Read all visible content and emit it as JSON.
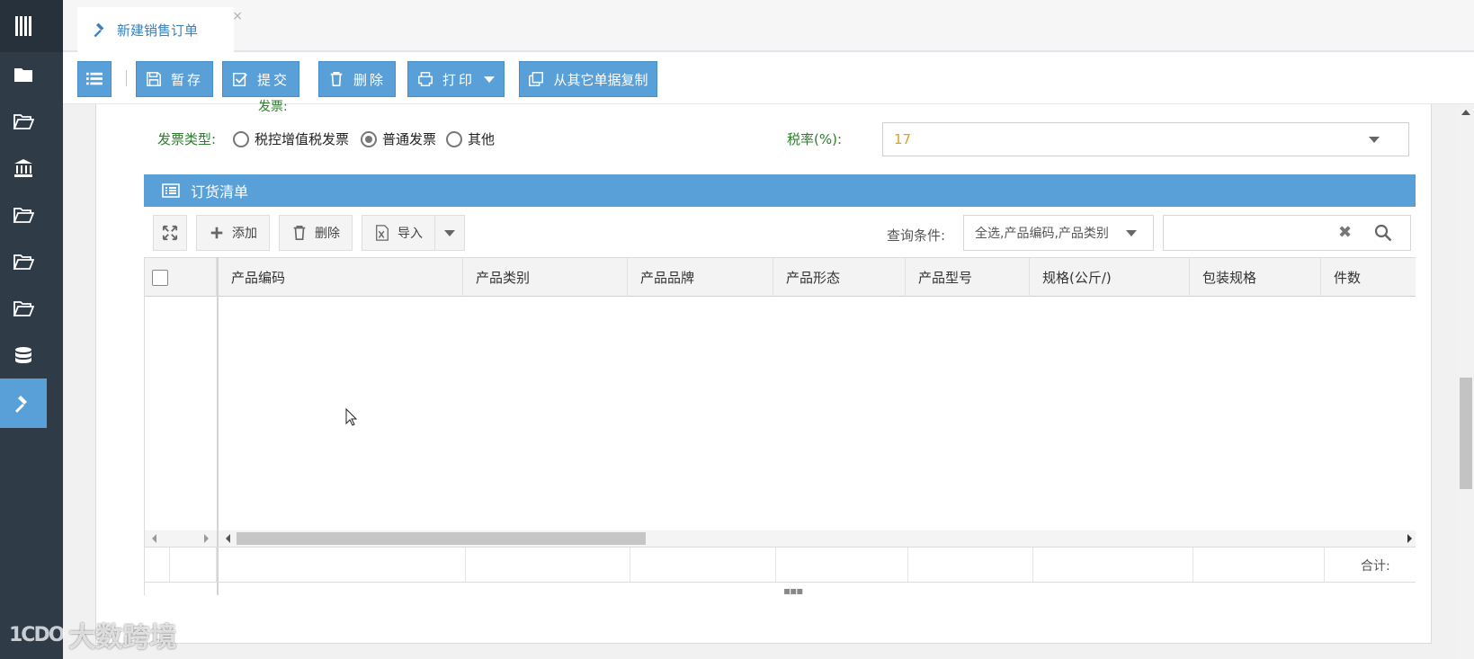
{
  "tab": {
    "label": "新建销售订单",
    "close_glyph": "×"
  },
  "toolbar": {
    "save": "暂存",
    "submit": "提交",
    "delete": "删除",
    "print": "打印",
    "copy": "从其它单据复制"
  },
  "form": {
    "cut_label": "发票:",
    "invoice_type_label": "发票类型:",
    "invoice_options": [
      "税控增值税发票",
      "普通发票",
      "其他"
    ],
    "invoice_selected": "普通发票",
    "tax_rate_label": "税率(%):",
    "tax_rate_value": "17"
  },
  "order_list": {
    "title": "订货清单",
    "add": "添加",
    "delete": "删除",
    "import": "导入",
    "query_label": "查询条件:",
    "query_value": "全选,产品编码,产品类别",
    "search_value": "",
    "columns": [
      "产品编码",
      "产品类别",
      "产品品牌",
      "产品形态",
      "产品型号",
      "规格(公斤/)",
      "包装规格",
      "件数"
    ],
    "rows": [],
    "total_label": "合计:"
  },
  "watermark": {
    "logo": "1CDO",
    "text": "大数跨境"
  },
  "colors": {
    "accent": "#5aa0d8",
    "rail": "#2f3b47",
    "label_green": "#2d7d2d",
    "value_orange": "#e0a020"
  }
}
